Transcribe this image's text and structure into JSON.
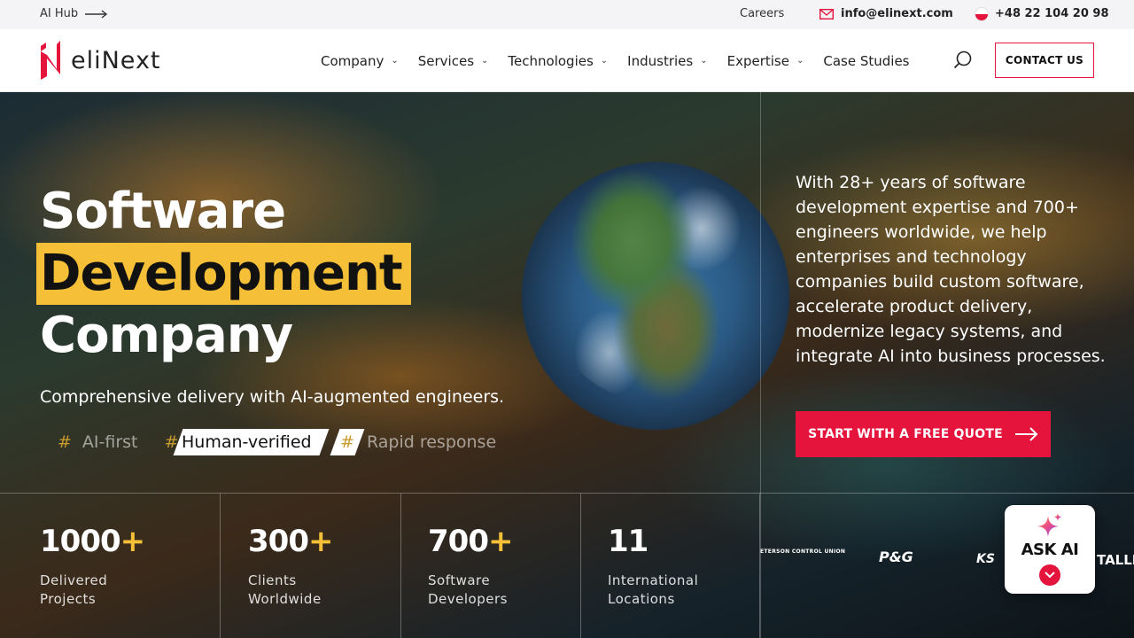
{
  "topbar": {
    "ai_hub": "AI Hub",
    "careers": "Careers",
    "email": "info@elinext.com",
    "phone": "+48 22 104 20 98"
  },
  "logo": {
    "text": "eliNext"
  },
  "nav": {
    "items": [
      {
        "label": "Company",
        "has_dropdown": true
      },
      {
        "label": "Services",
        "has_dropdown": true
      },
      {
        "label": "Technologies",
        "has_dropdown": true
      },
      {
        "label": "Industries",
        "has_dropdown": true
      },
      {
        "label": "Expertise",
        "has_dropdown": true
      },
      {
        "label": "Case Studies",
        "has_dropdown": false
      }
    ],
    "contact": "CONTACT US"
  },
  "hero": {
    "title_line1": "Software",
    "title_line2": "Development",
    "title_line3": "Company",
    "subtitle": "Comprehensive delivery with AI-augmented engineers.",
    "tags": [
      "AI-first",
      "Human-verified",
      "Rapid response"
    ],
    "description": "With 28+ years of software development expertise and 700+ engineers worldwide, we help enterprises and technology companies build custom software, accelerate product delivery, modernize legacy systems, and integrate AI into business processes.",
    "cta": "START WITH A FREE QUOTE"
  },
  "stats": [
    {
      "num": "1000",
      "plus": "+",
      "label1": "Delivered",
      "label2": "Projects"
    },
    {
      "num": "300",
      "plus": "+",
      "label1": "Clients",
      "label2": "Worldwide"
    },
    {
      "num": "700",
      "plus": "+",
      "label1": "Software",
      "label2": "Developers"
    },
    {
      "num": "11",
      "plus": "",
      "label1": "International",
      "label2": "Locations"
    }
  ],
  "clients": [
    "ETERSON CONTROL UNION",
    "P&G",
    "KS",
    "TALLI"
  ],
  "ask_ai": {
    "label": "ASK AI"
  },
  "colors": {
    "accent_red": "#e4143c",
    "accent_yellow": "#f5bf37"
  }
}
